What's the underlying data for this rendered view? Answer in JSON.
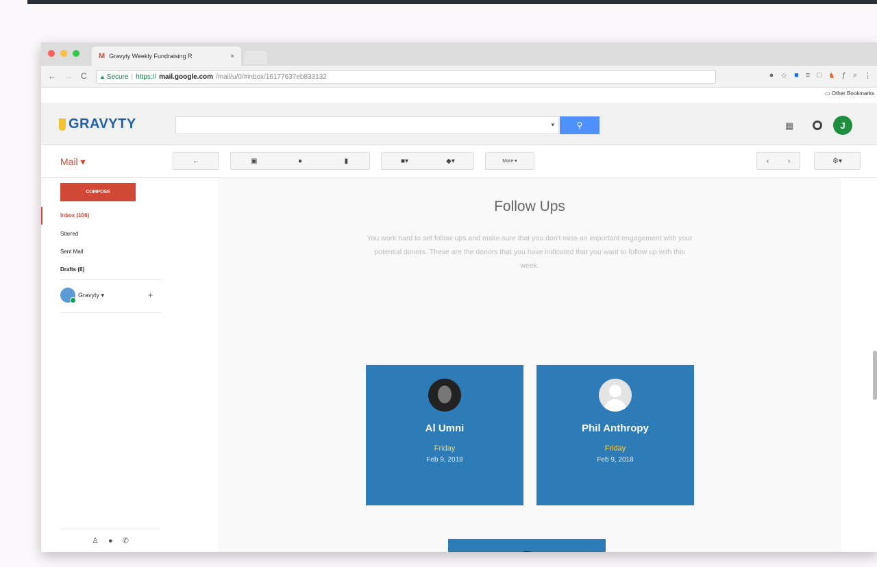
{
  "browser": {
    "tab_title": "Gravyty Weekly Fundraising R",
    "tab_close": "×",
    "secure_label": "Secure",
    "url_protocol": "https://",
    "url_host": "mail.google.com",
    "url_path": "/mail/u/0/#inbox/16177637eb833132",
    "bookmarks_label": "Other Bookmarks"
  },
  "header": {
    "logo_text": "GRAVYTY",
    "search_value": "",
    "avatar_letter": "J"
  },
  "toolbar": {
    "mail_label": "Mail ▾",
    "more_label": "More ▾"
  },
  "nav": {
    "compose_label": "COMPOSE",
    "items": [
      {
        "label": "Inbox (106)"
      },
      {
        "label": "Starred"
      },
      {
        "label": "Sent Mail"
      },
      {
        "label": "Drafts (8)"
      }
    ],
    "hangout_user": "Gravyty ▾",
    "hangout_add": "+"
  },
  "main": {
    "title": "Follow Ups",
    "description": "You work hard to set follow ups and make sure that you don't miss an important engagement with your potential donors. These are the donors that you have indicated that you want to follow up with this week.",
    "cards": [
      {
        "name": "Al Umni",
        "day": "Friday",
        "date": "Feb 9, 2018"
      },
      {
        "name": "Phil Anthropy",
        "day": "Friday",
        "date": "Feb 9, 2018"
      }
    ]
  },
  "colors": {
    "accent_red": "#d14836",
    "card_blue": "#2d7cb8",
    "logo_blue": "#1f5fa8",
    "search_blue": "#4d90fe"
  }
}
